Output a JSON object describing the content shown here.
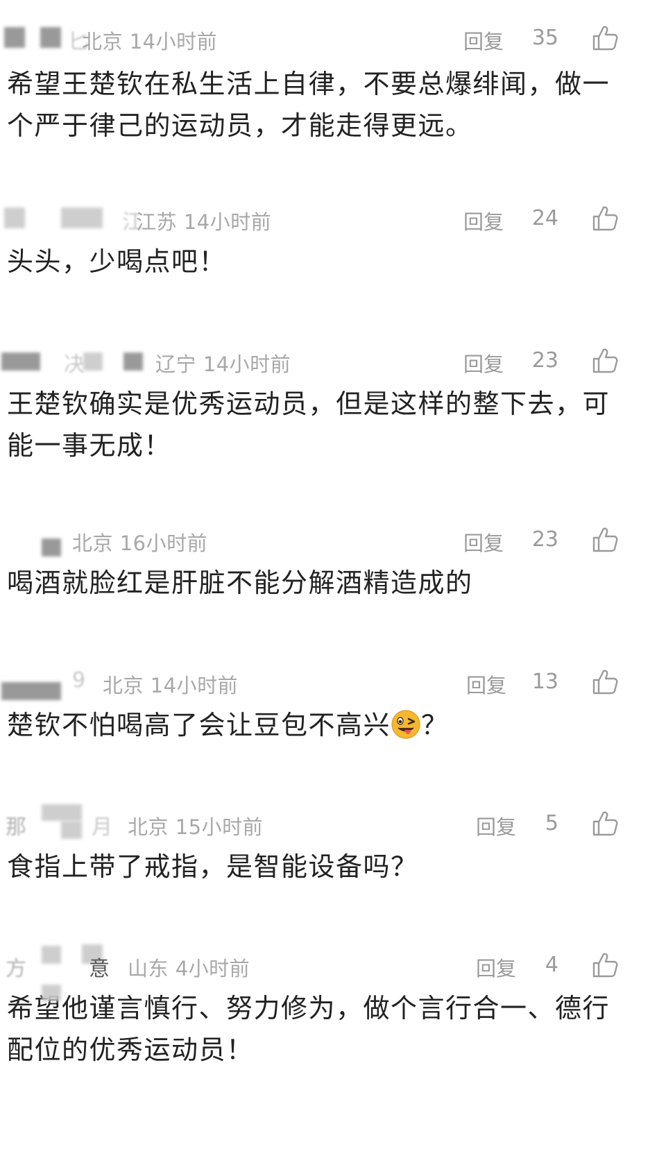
{
  "reply_label": "回复",
  "comments": [
    {
      "location": "北京",
      "time": "14小时前",
      "likes": "35",
      "text": "希望王楚钦在私生活上自律，不要总爆绯闻，做一个严于律己的运动员，才能走得更远。"
    },
    {
      "location": "江苏",
      "time": "14小时前",
      "likes": "24",
      "text": "头头，少喝点吧！"
    },
    {
      "location": "辽宁",
      "time": "14小时前",
      "likes": "23",
      "text": "王楚钦确实是优秀运动员，但是这样的整下去，可能一事无成！"
    },
    {
      "location": "北京",
      "time": "16小时前",
      "likes": "23",
      "text": "喝酒就脸红是肝脏不能分解酒精造成的"
    },
    {
      "location": "北京",
      "time": "14小时前",
      "likes": "13",
      "text_before_emoji": "楚钦不怕喝高了会让豆包不高兴",
      "emoji": "winking-face-with-tongue",
      "text_after_emoji": "？"
    },
    {
      "location": "北京",
      "time": "15小时前",
      "likes": "5",
      "text": "食指上带了戒指，是智能设备吗？"
    },
    {
      "location": "山东",
      "time": "4小时前",
      "likes": "4",
      "text": "希望他谨言慎行、努力修为，做个言行合一、德行配位的优秀运动员！"
    }
  ],
  "colors": {
    "meta_gray": "#a8a8a8",
    "text_dark": "#222222",
    "icon_gray": "#9a9a9a"
  }
}
